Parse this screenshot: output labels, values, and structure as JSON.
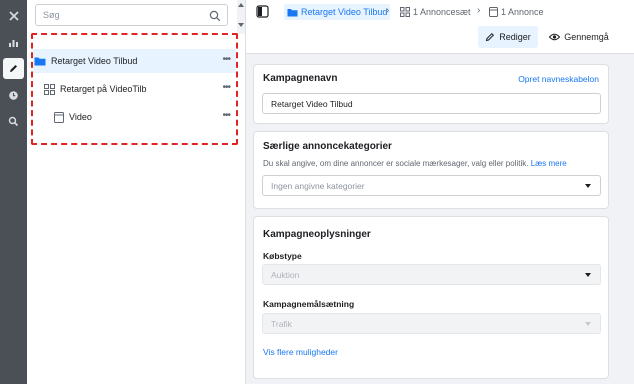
{
  "sidebar_rail": {
    "icons": [
      "close-icon",
      "chart-icon",
      "pencil-icon",
      "clock-icon",
      "zoom-icon"
    ]
  },
  "tree": {
    "search_placeholder": "Søg",
    "items": [
      {
        "label": "Retarget Video Tilbud",
        "icon": "folder-icon",
        "selected": true
      },
      {
        "label": "Retarget på VideoTilb",
        "icon": "grid-icon",
        "selected": false
      },
      {
        "label": "Video",
        "icon": "ad-icon",
        "selected": false
      }
    ],
    "more": "•••"
  },
  "header": {
    "breadcrumb": {
      "campaign": "Retarget Video Tilbud",
      "adset": "1 Annoncesæt",
      "ad": "1 Annonce"
    },
    "edit_label": "Rediger",
    "review_label": "Gennemgå"
  },
  "campaign_name": {
    "title": "Kampagnenavn",
    "template_link": "Opret navneskabelon",
    "value": "Retarget Video Tilbud"
  },
  "special_categories": {
    "title": "Særlige annoncekategorier",
    "description": "Du skal angive, om dine annoncer er sociale mærkesager, valg eller politik.",
    "learn_more": "Læs mere",
    "placeholder": "Ingen angivne kategorier"
  },
  "campaign_info": {
    "title": "Kampagneoplysninger",
    "buy_type_label": "Købstype",
    "buy_type_value": "Auktion",
    "objective_label": "Kampagnemålsætning",
    "objective_value": "Trafik",
    "more_options": "Vis flere muligheder"
  },
  "colors": {
    "accent": "#1877f2",
    "selection_outline": "#e02424",
    "rail": "#4b4f56"
  }
}
